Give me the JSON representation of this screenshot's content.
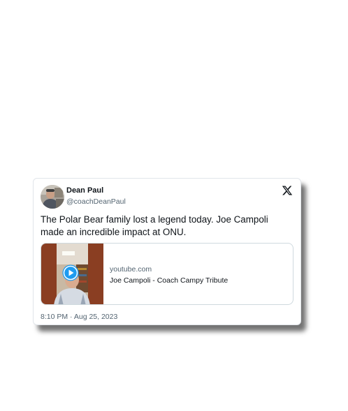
{
  "tweet": {
    "author": {
      "display_name": "Dean Paul",
      "handle": "@coachDeanPaul",
      "avatar": "profile-photo"
    },
    "platform_icon": "x-logo-icon",
    "text": "The Polar Bear family lost a legend today. Joe Campoli made an incredible impact at ONU.",
    "link_card": {
      "domain": "youtube.com",
      "title": "Joe Campoli - Coach Campy Tribute",
      "thumbnail_icon": "play-icon"
    },
    "timestamp": "8:10 PM · Aug 25, 2023"
  },
  "colors": {
    "text_primary": "#0f1419",
    "text_secondary": "#536471",
    "border": "#cfd9de",
    "play_button": "#1d9bf0"
  }
}
